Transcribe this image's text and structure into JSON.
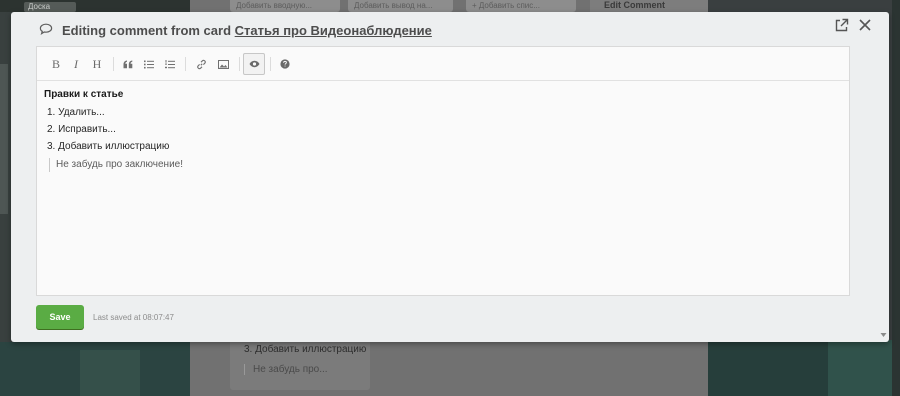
{
  "background": {
    "board_tab": "Доска",
    "cards_top": [
      "Добавить вводную...",
      "Добавить вывод на...",
      "+ Добавить спис..."
    ],
    "edit_panel_title": "Edit Comment",
    "lower_card": {
      "item": "3. Добавить иллюстрацию",
      "quote": "Не забудь про..."
    }
  },
  "modal": {
    "title_prefix": "Editing comment from card",
    "card_link": "Статья про Видеонаблюдение",
    "icons": {
      "comment": "speech-bubble-icon",
      "open_external": "external-link-icon",
      "close": "close-icon"
    }
  },
  "toolbar": {
    "bold": "B",
    "italic": "I",
    "heading": "H",
    "buttons": [
      "bold",
      "italic",
      "heading",
      "quote",
      "unordered-list",
      "ordered-list",
      "link",
      "image",
      "preview",
      "help"
    ],
    "active": "preview"
  },
  "comment": {
    "heading": "Правки к статье",
    "list": [
      "1. Удалить...",
      "2. Исправить...",
      "3. Добавить иллюстрацию"
    ],
    "quote": "Не забудь про заключение!"
  },
  "footer": {
    "save_label": "Save",
    "last_saved": "Last saved at 08:07:47"
  },
  "colors": {
    "save_button": "#5aac44",
    "modal_bg": "#edeff0"
  }
}
